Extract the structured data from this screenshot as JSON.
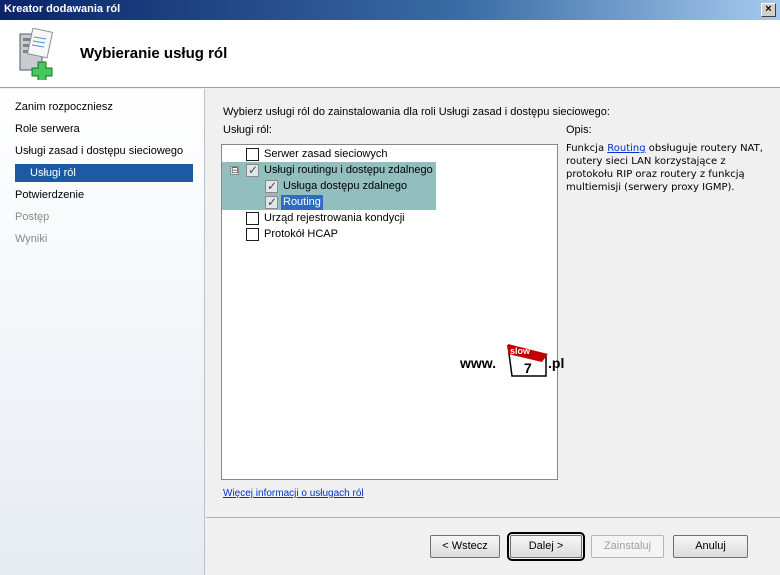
{
  "window": {
    "title": "Kreator dodawania ról",
    "close_glyph": "×"
  },
  "header": {
    "heading": "Wybieranie usług ról",
    "icon": "server-roles-add-icon"
  },
  "nav": {
    "items": [
      {
        "label": "Zanim rozpoczniesz",
        "state": "normal"
      },
      {
        "label": "Role serwera",
        "state": "normal"
      },
      {
        "label": "Usługi zasad i dostępu sieciowego",
        "state": "normal"
      },
      {
        "label": "Usługi ról",
        "state": "active"
      },
      {
        "label": "Potwierdzenie",
        "state": "normal"
      },
      {
        "label": "Postęp",
        "state": "disabled"
      },
      {
        "label": "Wyniki",
        "state": "disabled"
      }
    ]
  },
  "main": {
    "instruction": "Wybierz usługi ról do zainstalowania dla roli Usługi zasad i dostępu sieciowego:",
    "services_label": "Usługi ról:",
    "description_label": "Opis:",
    "services": [
      {
        "label": "Serwer zasad sieciowych",
        "checked": false
      },
      {
        "label": "Usługi routingu i dostępu zdalnego",
        "checked": true,
        "expanded": true,
        "expander": "⊟"
      },
      {
        "label": "Usługa dostępu zdalnego",
        "checked": true
      },
      {
        "label": "Routing",
        "checked": true,
        "selected": true
      },
      {
        "label": "Urząd rejestrowania kondycji",
        "checked": false
      },
      {
        "label": "Protokół HCAP",
        "checked": false
      }
    ],
    "description": {
      "before_link": "Funkcja ",
      "link": "Routing",
      "after_link": " obsługuje routery NAT, routery sieci LAN korzystające z protokołu RIP oraz routery z funkcją multiemisji (serwery proxy IGMP)."
    },
    "more_info_link": "Więcej informacji o usługach ról"
  },
  "watermark": {
    "prefix": "www.",
    "logo_text": "slow",
    "logo_digit": "7",
    "suffix": ".pl",
    "logo_color": "#c00000"
  },
  "buttons": {
    "back": "< Wstecz",
    "next": "Dalej >",
    "install": "Zainstaluj",
    "cancel": "Anuluj"
  },
  "colors": {
    "selection_band": "#7fb3b3",
    "active_nav": "#1c5aa5",
    "link": "#0033cc"
  }
}
